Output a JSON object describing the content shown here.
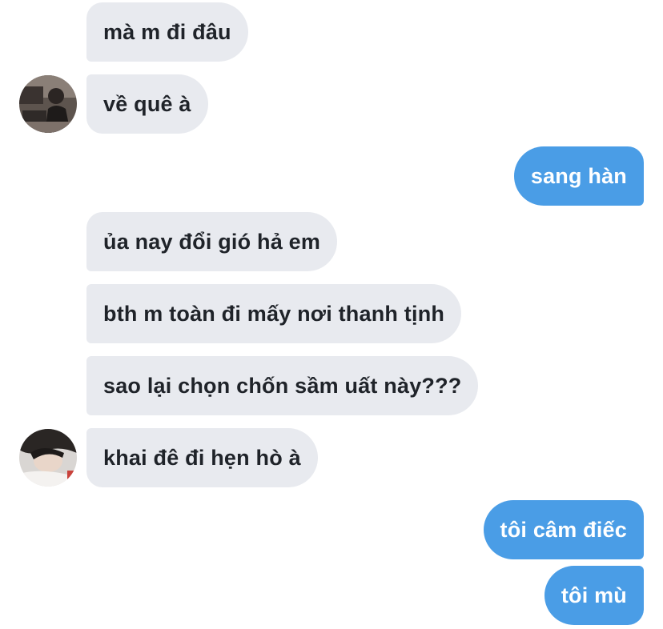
{
  "messages": [
    {
      "side": "incoming",
      "text": "mà m đi đâu"
    },
    {
      "side": "incoming",
      "text": "về quê à"
    },
    {
      "side": "outgoing",
      "text": "sang hàn"
    },
    {
      "side": "incoming",
      "text": "ủa nay đổi gió hả em"
    },
    {
      "side": "incoming",
      "text": "bth m toàn đi mấy nơi thanh tịnh"
    },
    {
      "side": "incoming",
      "text": "sao lại chọn chốn sầm uất này???"
    },
    {
      "side": "incoming",
      "text": "khai đê đi hẹn hò à"
    },
    {
      "side": "outgoing",
      "text": "tôi câm điếc"
    },
    {
      "side": "outgoing",
      "text": "tôi mù"
    }
  ],
  "colors": {
    "incoming_bubble": "#e8eaef",
    "outgoing_bubble": "#4a9de6",
    "incoming_text": "#1f2329",
    "outgoing_text": "#ffffff"
  }
}
